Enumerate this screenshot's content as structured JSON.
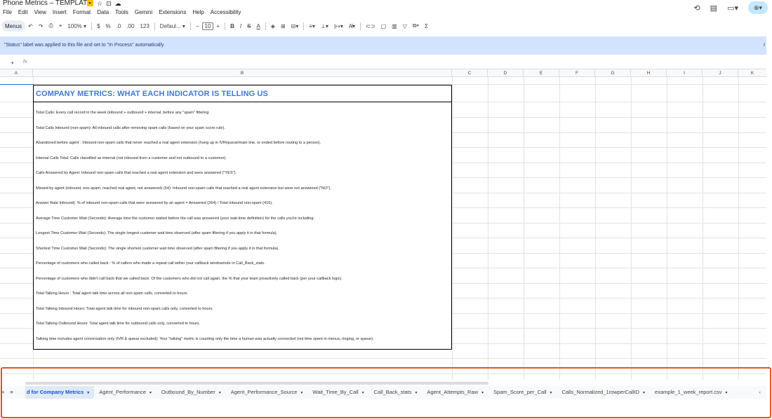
{
  "app": {
    "doc_title": "Phone Metrics – TEMPLATE",
    "menu": [
      "File",
      "Edit",
      "View",
      "Insert",
      "Format",
      "Data",
      "Tools",
      "Gemini",
      "Extensions",
      "Help",
      "Accessibility"
    ],
    "title_icons": [
      "status-label-icon",
      "star-icon",
      "move-icon",
      "cloud-saved-icon"
    ],
    "top_right_icons": [
      "history-icon",
      "comment-icon",
      "meet-icon",
      "share-icon"
    ]
  },
  "toolbar": {
    "menus_label": "Menus",
    "zoom": "100%",
    "currency": "$",
    "percent": "%",
    "decimal_decrease": ".0",
    "decimal_increase": ".00",
    "number_format": "123",
    "font": "Defaul...",
    "font_size": "10",
    "bold": "B",
    "italic": "I",
    "strikethrough": "S",
    "text_color": "A",
    "sum": "Σ"
  },
  "banner": {
    "text": "\"Status\" label was applied to this file and set to \"In Process\" automatically",
    "edge_char": "I"
  },
  "formula_bar": {
    "fx": "fx"
  },
  "columns": [
    "A",
    "B",
    "C",
    "D",
    "E",
    "F",
    "G",
    "H",
    "I",
    "J",
    "K"
  ],
  "metrics": {
    "title": "COMPANY METRICS: WHAT EACH INDICATOR IS TELLING US",
    "rows": [
      "Total Calls: Every call record in the week (inbound + outbound + internal, before any \"spam\" filtering",
      "Total Calls Inbound (non-spam): All inbound calls after removing spam calls (based on your spam score rule).",
      "Abandoned before agent : Inbound non-spam calls that never reached a real agent extension (hung up in IVR/queue/main line, or ended before routing to a person).",
      "Internal Calls Total: Calls classified as internal (not inbound from a customer and not outbound to a customer).",
      "Calls Answered by Agent: Inbound non-spam calls that reached a real agent extension and were answered (\"YES\").",
      "Missed by agent (inbound, non-spam, reached real agent, not answered) (54): Inbound non-spam calls that reached a real agent extension but were not answered (\"NO\").",
      "Answer Rate Inbound): % of inbound non-spam calls that were answered by an agent = Answered (264) / Total inbound non-spam (416).",
      "Average Time Customer Wait (Seconds): Average time the customer waited before the call was answered (your wait-time definition) for the calls you're including.",
      "Longest Time Customer Wait (Seconds): The single longest customer wait time observed (after spam filtering if you apply it in that formula).",
      "Shortest Time Customer Wait (Seconds): The single shortest customer wait time observed (after spam filtering if you apply it in that formula).",
      "Percentage of customers who called back : % of callers who made a repeat call within your callback window/rule in Call_Back_stats.",
      "Percentage of customers who didn't call back that we called back: Of the customers who did not call again, the % that your team proactively called back (per your callback logic).",
      "Total Talking Hours : Total agent talk time across all non-spam calls, converted to hours.",
      "Total Talking Inbound Hours: Total agent talk time for inbound non-spam calls only, converted to hours.",
      "Total Talking Outbound Hours: Total agent talk time for outbound calls only, converted to hours.",
      "Talking time includes agent conversation only (IVR & queue excluded): Your \"talking\" metric is counting only the time a human was actually connected (not time spent in menus, ringing, or queue)."
    ]
  },
  "sheets": {
    "tabs": [
      "d for Company Metrics",
      "Agent_Performance",
      "Outbound_By_Number",
      "Agent_Performance_Source",
      "Wait_Time_By_Call",
      "Call_Back_stats",
      "Agent_Attempts_Raw",
      "Spam_Score_per_Call",
      "Calls_Normalized_1rowperCallID",
      "example_1_week_report.csv"
    ],
    "active_index": 0,
    "add_symbol": "+",
    "all_sheets_symbol": "≡",
    "nav_symbol": "‹"
  },
  "colors": {
    "accent_title": "#3c78d8",
    "banner_bg": "#d3e3fd",
    "highlight": "#e2561d",
    "active_tab_text": "#0b57d0"
  }
}
